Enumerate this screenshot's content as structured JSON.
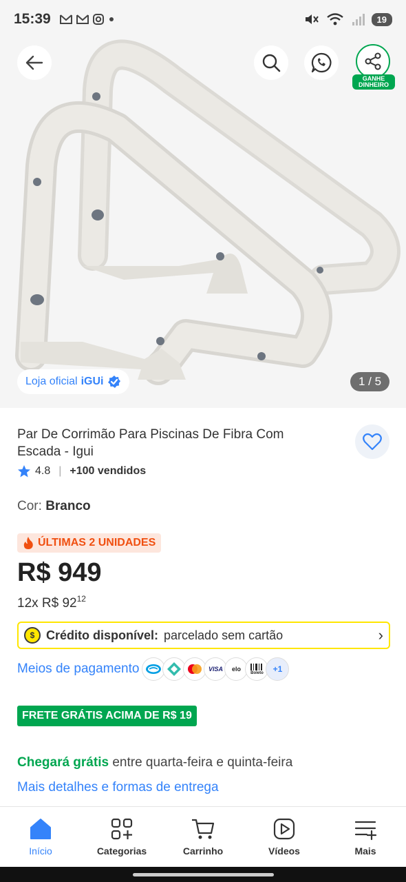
{
  "status_bar": {
    "time": "15:39",
    "left_icons": [
      "gmail-icon",
      "gmail-icon",
      "instagram-icon",
      "dot-icon"
    ],
    "battery": "19"
  },
  "hero": {
    "store_prefix": "Loja oficial",
    "store_name": "iGUi",
    "image_counter": "1 / 5",
    "share_badge": "GANHE DINHEIRO",
    "product_color": "#e9e7e2"
  },
  "product": {
    "title": "Par De Corrimão Para Piscinas De Fibra Com Escada - Igui",
    "rating": "4.8",
    "sold": "+100 vendidos",
    "color_label": "Cor:",
    "color_value": "Branco",
    "stock_badge": "ÚLTIMAS 2 UNIDADES",
    "price": "R$ 949",
    "installments_prefix": "12x R$ 92",
    "installments_cents": "12"
  },
  "credit": {
    "label": "Crédito disponível:",
    "text": "parcelado sem cartão"
  },
  "payment": {
    "label": "Meios de pagamento",
    "methods": [
      "mercado-pago-icon",
      "pix-icon",
      "mastercard-icon",
      "visa-icon",
      "elo-icon",
      "boleto-icon"
    ],
    "more": "+1",
    "visa_text": "VISA",
    "elo_text": "elo",
    "boleto_text": "Boleto"
  },
  "shipping": {
    "free_badge": "FRETE GRÁTIS ACIMA DE R$ 19",
    "arrival_highlight": "Chegará grátis",
    "arrival_text": "entre quarta-feira e quinta-feira",
    "details_link": "Mais detalhes e formas de entrega"
  },
  "bottom_nav": {
    "items": [
      {
        "label": "Início",
        "icon": "home-icon",
        "active": true
      },
      {
        "label": "Categorias",
        "icon": "categories-icon",
        "active": false
      },
      {
        "label": "Carrinho",
        "icon": "cart-icon",
        "active": false
      },
      {
        "label": "Vídeos",
        "icon": "video-icon",
        "active": false
      },
      {
        "label": "Mais",
        "icon": "menu-plus-icon",
        "active": false
      }
    ]
  },
  "colors": {
    "brand_blue": "#3483fa",
    "green": "#00a650",
    "yellow": "#ffe600",
    "urgency_orange": "#f04f10"
  }
}
